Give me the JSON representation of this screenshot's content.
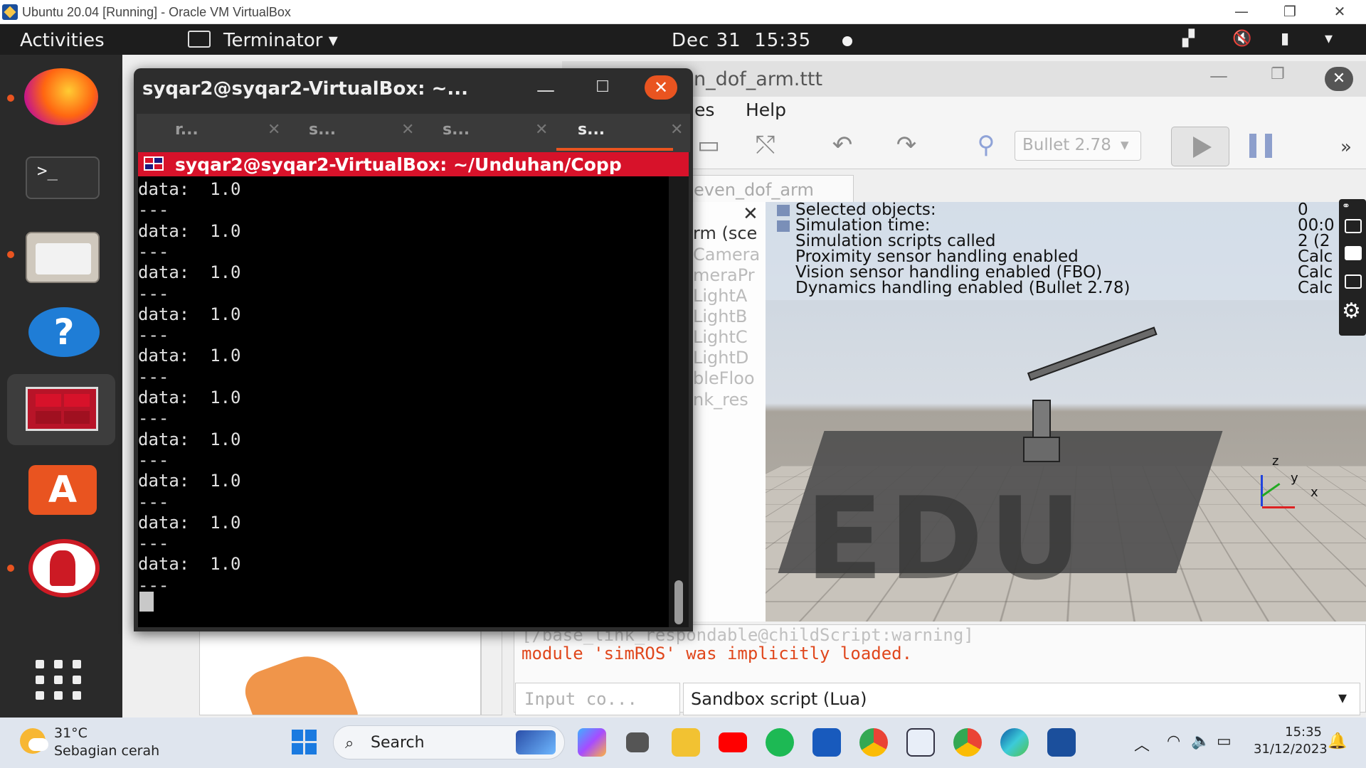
{
  "vbox": {
    "title": "Ubuntu 20.04 [Running] - Oracle VM VirtualBox",
    "minimize": "—",
    "restore": "❐",
    "close": "✕"
  },
  "ubuntu_topbar": {
    "activities": "Activities",
    "app_name": "Terminator ▾",
    "date": "Dec 31",
    "time": "15:35",
    "tray_icons": [
      "network-icon",
      "volume-muted-icon",
      "battery-icon",
      "system-menu-icon"
    ]
  },
  "dock": {
    "items": [
      "firefox",
      "terminal",
      "files",
      "help",
      "terminator",
      "ubuntu-software",
      "coppeliasim-edu",
      "show-applications"
    ]
  },
  "terminator": {
    "title": "syqar2@syqar2-VirtualBox: ~...",
    "tabs": [
      {
        "label": "r...",
        "active": false
      },
      {
        "label": "s...",
        "active": false
      },
      {
        "label": "s...",
        "active": false
      },
      {
        "label": "s...",
        "active": true
      }
    ],
    "pane_title": "syqar2@syqar2-VirtualBox: ~/Unduhan/Copp",
    "lines": [
      "data:  1.0",
      "---",
      "data:  1.0",
      "---",
      "data:  1.0",
      "---",
      "data:  1.0",
      "---",
      "data:  1.0",
      "---",
      "data:  1.0",
      "---",
      "data:  1.0",
      "---",
      "data:  1.0",
      "---",
      "data:  1.0",
      "---",
      "data:  1.0",
      "---"
    ]
  },
  "coppelia": {
    "title": "n_dof_arm.ttt",
    "menu": [
      "es",
      "Help"
    ],
    "engine": "Bullet 2.78",
    "scene_tab": "even_dof_arm",
    "hierarchy": [
      "rm (sce",
      "Camera",
      "meraPr",
      "LightA",
      "LightB",
      "LightC",
      "LightD",
      "bleFloo",
      "nk_res"
    ],
    "info_labels": [
      "Selected objects:",
      "Simulation time:",
      "Simulation scripts called",
      "Proximity sensor handling enabled",
      "Vision sensor handling enabled (FBO)",
      "Dynamics handling enabled (Bullet 2.78)"
    ],
    "info_values": [
      "0",
      "00:0",
      "2 (2",
      "Calc",
      "Calc",
      "Calc"
    ],
    "watermark": "EDU",
    "axes": {
      "z": "z",
      "y": "y",
      "x": "x"
    },
    "console_line1": "[/base_link_respondable@childScript:warning]",
    "console_line2": "module 'simROS' was implicitly loaded.",
    "input_placeholder": "Input  co...",
    "script_type": "Sandbox script (Lua)",
    "dropdown_arrow": "▾"
  },
  "windows_taskbar": {
    "temperature": "31°C",
    "weather": "Sebagian cerah",
    "search": "Search",
    "time": "15:35",
    "date": "31/12/2023",
    "apps": [
      "copilot",
      "task-view",
      "file-explorer",
      "youtube",
      "spotify",
      "word",
      "chrome-profile",
      "virtualbox-3d",
      "chrome",
      "edge",
      "virtualbox"
    ]
  }
}
